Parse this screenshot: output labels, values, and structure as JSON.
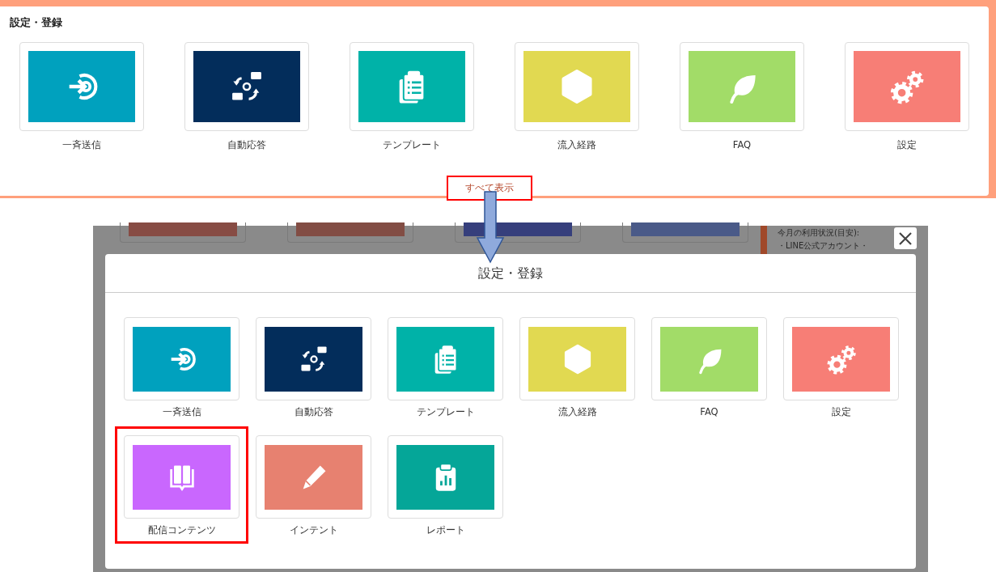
{
  "panel": {
    "title": "設定・登録",
    "tiles": [
      {
        "label": "一斉送信",
        "color": "#00a1be"
      },
      {
        "label": "自動応答",
        "color": "#032d5b"
      },
      {
        "label": "テンプレート",
        "color": "#00b2a8"
      },
      {
        "label": "流入経路",
        "color": "#e1d951"
      },
      {
        "label": "FAQ",
        "color": "#a2dc68"
      },
      {
        "label": "設定",
        "color": "#f77e76"
      }
    ],
    "show_all": "すべて表示"
  },
  "background": {
    "texts": [
      "今月の利用状況(目安):",
      "・LINE公式アカウント・"
    ]
  },
  "modal": {
    "title": "設定・登録",
    "tiles": [
      {
        "label": "一斉送信",
        "color": "#00a1be",
        "highlighted": false
      },
      {
        "label": "自動応答",
        "color": "#032d5b",
        "highlighted": false
      },
      {
        "label": "テンプレート",
        "color": "#00b2a8",
        "highlighted": false
      },
      {
        "label": "流入経路",
        "color": "#e1d951",
        "highlighted": false
      },
      {
        "label": "FAQ",
        "color": "#a2dc68",
        "highlighted": false
      },
      {
        "label": "設定",
        "color": "#f77e76",
        "highlighted": false
      },
      {
        "label": "配信コンテンツ",
        "color": "#c967fe",
        "highlighted": true
      },
      {
        "label": "インテント",
        "color": "#e78170",
        "highlighted": false
      },
      {
        "label": "レポート",
        "color": "#05a698",
        "highlighted": false
      }
    ]
  }
}
